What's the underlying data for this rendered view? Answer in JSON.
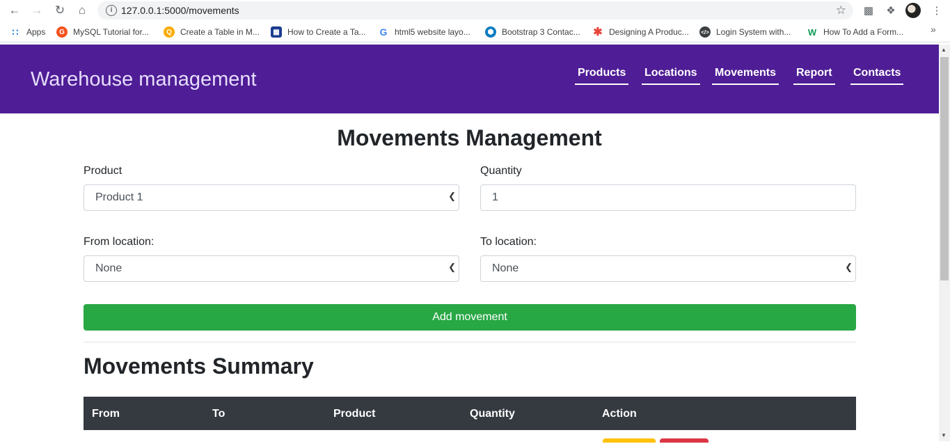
{
  "browser": {
    "url": "127.0.0.1:5000/movements",
    "bookmarks": [
      {
        "label": "Apps",
        "icon": "apps-grid-icon",
        "color": "#1a73e8"
      },
      {
        "label": "MySQL Tutorial for...",
        "icon": "mysql-tutorial-icon",
        "color": "#f4511e"
      },
      {
        "label": "Create a Table in M...",
        "icon": "search-magnifier-icon",
        "color": "#f9ab00"
      },
      {
        "label": "How to Create a Ta...",
        "icon": "table-grid-icon",
        "color": "#1a3d8f"
      },
      {
        "label": "html5 website layo...",
        "icon": "google-icon",
        "color": "#4285f4"
      },
      {
        "label": "Bootstrap 3 Contac...",
        "icon": "hexagon-icon",
        "color": "#0a7cc1"
      },
      {
        "label": "Designing A Produc...",
        "icon": "asterisk-icon",
        "color": "#e8453c"
      },
      {
        "label": "Login System with...",
        "icon": "code-icon",
        "color": "#3c4043"
      },
      {
        "label": "How To Add a Form...",
        "icon": "w-logo-icon",
        "color": "#0f9d58"
      }
    ]
  },
  "header": {
    "brand": "Warehouse management",
    "nav": [
      "Products",
      "Locations",
      "Movements",
      "Report",
      "Contacts"
    ]
  },
  "form": {
    "title": "Movements Management",
    "product_label": "Product",
    "product_value": "Product 1",
    "quantity_label": "Quantity",
    "quantity_value": "1",
    "from_label": "From location:",
    "from_value": "None",
    "to_label": "To location:",
    "to_value": "None",
    "submit_label": "Add movement"
  },
  "summary": {
    "title": "Movements Summary",
    "columns": [
      "From",
      "To",
      "Product",
      "Quantity",
      "Action"
    ]
  },
  "colors": {
    "header_bg": "#4f1d96",
    "add_button": "#28a745",
    "table_head": "#343a40",
    "edit_button": "#ffc107",
    "delete_button": "#dc3545"
  }
}
